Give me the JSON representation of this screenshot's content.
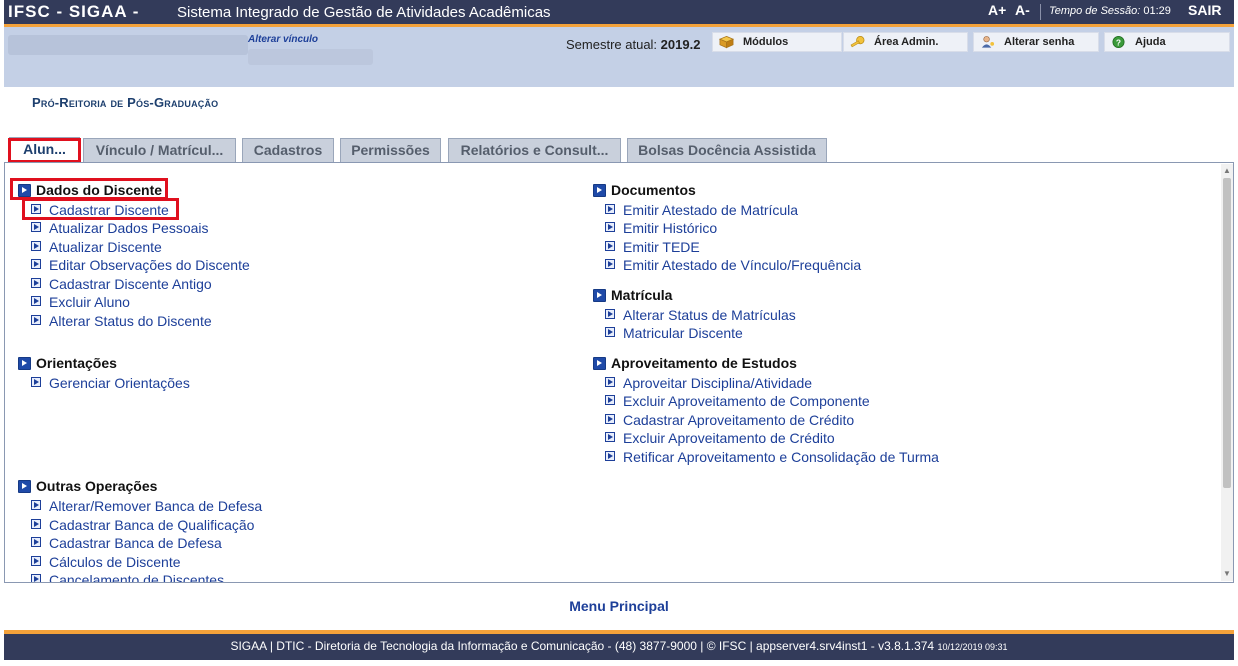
{
  "header": {
    "brand": "IFSC - SIGAA -",
    "subtitle": "Sistema Integrado de Gestão de Atividades Acadêmicas",
    "font_increase": "A+",
    "font_decrease": "A-",
    "session_label": "Tempo de Sessão:",
    "session_time": "01:29",
    "logout": "SAIR"
  },
  "infobar": {
    "alterar_vinculo": "Alterar vínculo",
    "semestre_label": "Semestre atual:",
    "semestre_value": "2019.2",
    "buttons": {
      "modulos": "Módulos",
      "area_admin": "Área Admin.",
      "alterar_senha": "Alterar senha",
      "ajuda": "Ajuda"
    }
  },
  "section_title": "Pró-Reitoria de Pós-Graduação",
  "tabs": [
    {
      "label": "Alun..."
    },
    {
      "label": "Vínculo / Matrícul..."
    },
    {
      "label": "Cadastros"
    },
    {
      "label": "Permissões"
    },
    {
      "label": "Relatórios e Consult..."
    },
    {
      "label": "Bolsas Docência Assistida"
    }
  ],
  "groups": {
    "dados_discente": {
      "title": "Dados do Discente",
      "items": [
        "Cadastrar Discente",
        "Atualizar Dados Pessoais",
        "Atualizar Discente",
        "Editar Observações do Discente",
        "Cadastrar Discente Antigo",
        "Excluir Aluno",
        "Alterar Status do Discente"
      ]
    },
    "orientacoes": {
      "title": "Orientações",
      "items": [
        "Gerenciar Orientações"
      ]
    },
    "outras": {
      "title": "Outras Operações",
      "items": [
        "Alterar/Remover Banca de Defesa",
        "Cadastrar Banca de Qualificação",
        "Cadastrar Banca de Defesa",
        "Cálculos de Discente",
        "Cancelamento de Discentes"
      ]
    },
    "documentos": {
      "title": "Documentos",
      "items": [
        "Emitir Atestado de Matrícula",
        "Emitir Histórico",
        "Emitir TEDE",
        "Emitir Atestado de Vínculo/Frequência"
      ]
    },
    "matricula": {
      "title": "Matrícula",
      "items": [
        "Alterar Status de Matrículas",
        "Matricular Discente"
      ]
    },
    "aproveitamento": {
      "title": "Aproveitamento de Estudos",
      "items": [
        "Aproveitar Disciplina/Atividade",
        "Excluir Aproveitamento de Componente",
        "Cadastrar Aproveitamento de Crédito",
        "Excluir Aproveitamento de Crédito",
        "Retificar Aproveitamento e Consolidação de Turma"
      ]
    }
  },
  "menu_principal": "Menu Principal",
  "footer": {
    "text": "SIGAA | DTIC - Diretoria de Tecnologia da Informação e Comunicação - (48) 3877-9000 | © IFSC | appserver4.srv4inst1 - v3.8.1.374",
    "timestamp": "10/12/2019 09:31"
  },
  "colors": {
    "header_bg": "#333b5a",
    "accent_orange": "#f4a23a",
    "infobar_bg": "#c4d0e6",
    "link_blue": "#1d3f99",
    "highlight_red": "#e0101e"
  }
}
